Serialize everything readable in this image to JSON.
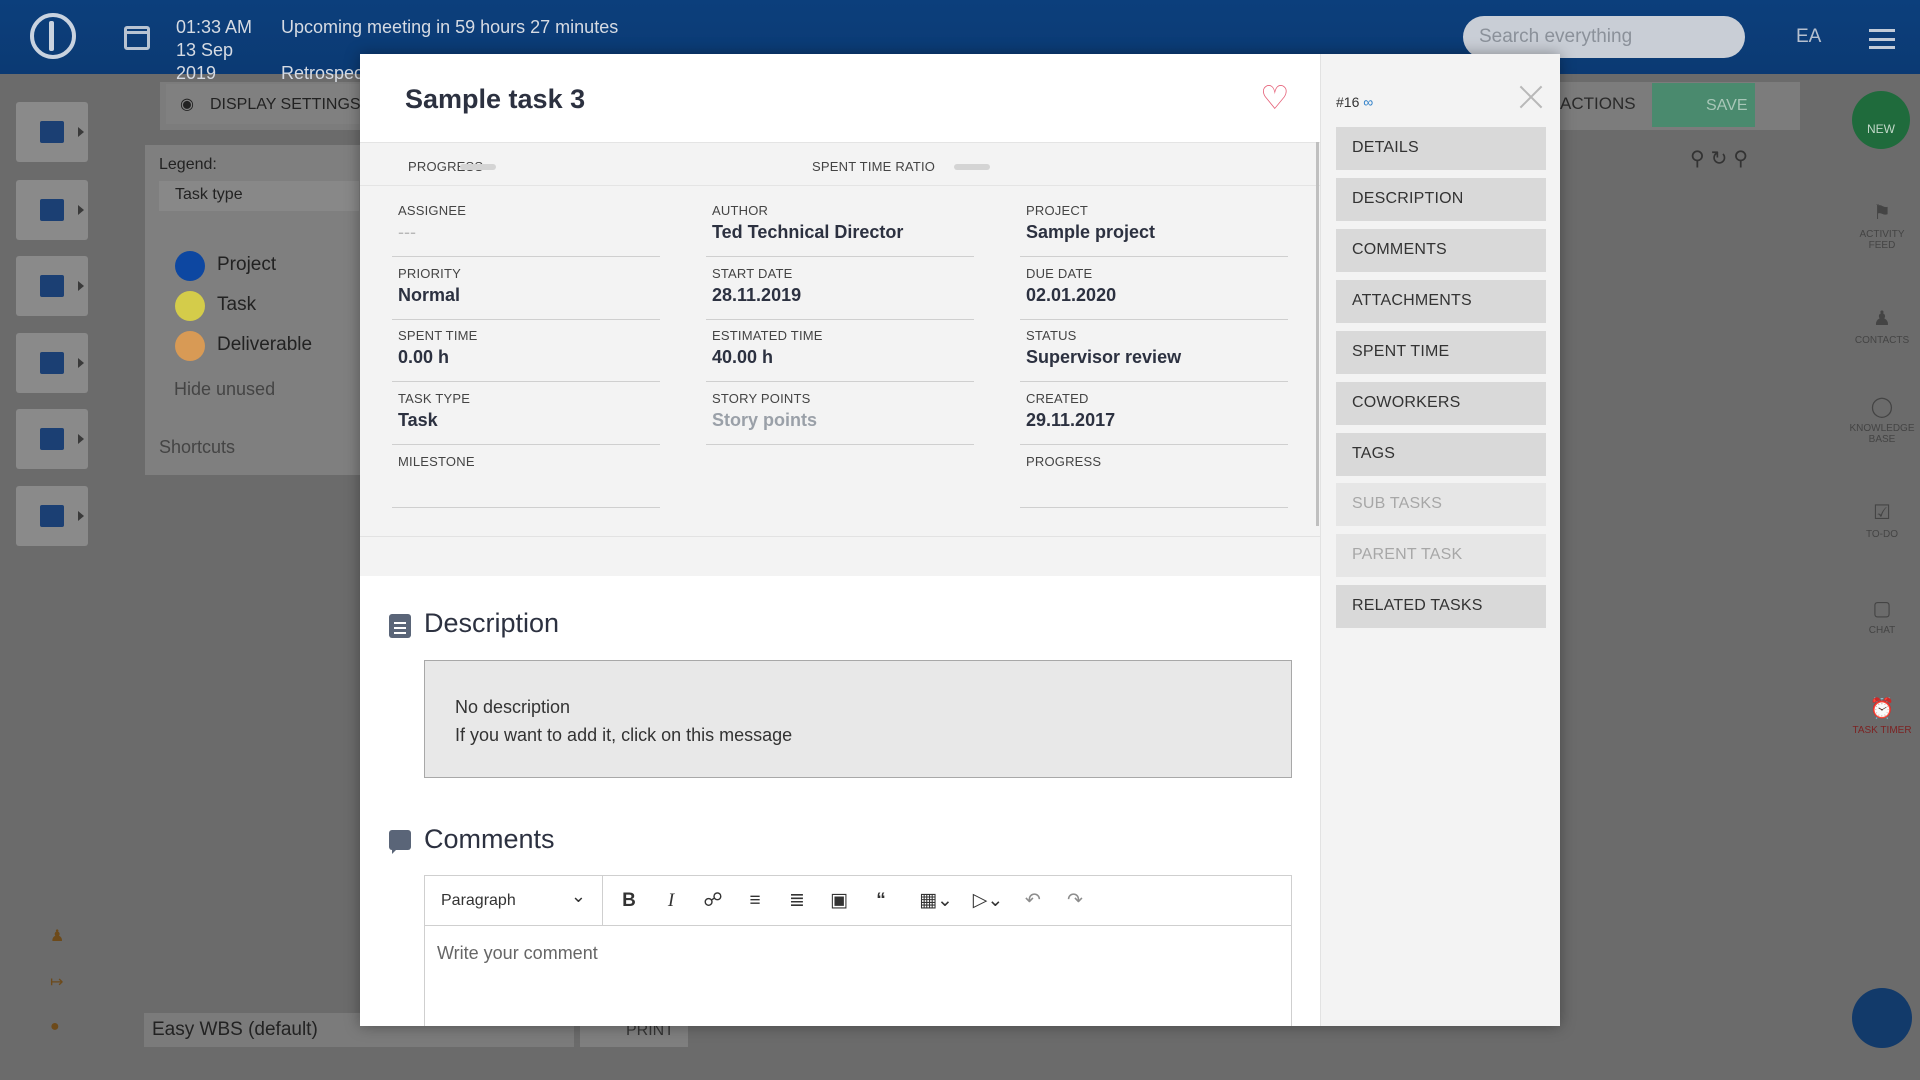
{
  "topbar": {
    "time": "01:33 AM",
    "meeting_text": "Upcoming meeting in 59 hours 27 minutes",
    "date": "13 Sep 2019",
    "meeting_name": "Retrospective meeting",
    "search_placeholder": "Search everything",
    "user_initials": "EA"
  },
  "background": {
    "display_settings": "DISPLAY SETTINGS",
    "actions": "ACTIONS",
    "save": "SAVE",
    "new": "NEW",
    "legend_label": "Legend:",
    "legend_select": "Task type",
    "legend_items": [
      {
        "label": "Project",
        "color": "#0d47a1"
      },
      {
        "label": "Task",
        "color": "#d4cc4a"
      },
      {
        "label": "Deliverable",
        "color": "#d89a55"
      }
    ],
    "hide_unused": "Hide unused",
    "shortcuts": "Shortcuts",
    "wbs_select": "Easy WBS (default)",
    "print": "PRINT",
    "right_rail": [
      "ACTIVITY FEED",
      "CONTACTS",
      "KNOWLEDGE BASE",
      "TO-DO",
      "CHAT",
      "TASK TIMER"
    ]
  },
  "modal": {
    "title": "Sample task 3",
    "task_id": "#16",
    "progress_label": "PROGRESS",
    "spent_ratio_label": "SPENT TIME RATIO",
    "fields": [
      {
        "label": "ASSIGNEE",
        "value": "---"
      },
      {
        "label": "AUTHOR",
        "value": "Ted Technical Director"
      },
      {
        "label": "PROJECT",
        "value": "Sample project"
      },
      {
        "label": "PRIORITY",
        "value": "Normal"
      },
      {
        "label": "START DATE",
        "value": "28.11.2019"
      },
      {
        "label": "DUE DATE",
        "value": "02.01.2020"
      },
      {
        "label": "SPENT TIME",
        "value": "0.00 h"
      },
      {
        "label": "ESTIMATED TIME",
        "value": "40.00 h"
      },
      {
        "label": "STATUS",
        "value": "Supervisor review"
      },
      {
        "label": "TASK TYPE",
        "value": "Task"
      },
      {
        "label": "STORY POINTS",
        "value": "Story points"
      },
      {
        "label": "CREATED",
        "value": "29.11.2017"
      },
      {
        "label": "MILESTONE",
        "value": ""
      },
      {
        "label": "PROGRESS",
        "value": ""
      }
    ],
    "description_title": "Description",
    "description_line1": "No description",
    "description_line2": "If you want to add it, click on this message",
    "comments_title": "Comments",
    "editor_paragraph": "Paragraph",
    "comment_placeholder": "Write your comment",
    "nav": [
      {
        "label": "DETAILS",
        "enabled": true
      },
      {
        "label": "DESCRIPTION",
        "enabled": true
      },
      {
        "label": "COMMENTS",
        "enabled": true
      },
      {
        "label": "ATTACHMENTS",
        "enabled": true
      },
      {
        "label": "SPENT TIME",
        "enabled": true
      },
      {
        "label": "COWORKERS",
        "enabled": true
      },
      {
        "label": "TAGS",
        "enabled": true
      },
      {
        "label": "SUB TASKS",
        "enabled": false
      },
      {
        "label": "PARENT TASK",
        "enabled": false
      },
      {
        "label": "RELATED TASKS",
        "enabled": true
      }
    ],
    "accent_heart": "#e6637a",
    "link_color": "#2e7fc8"
  }
}
